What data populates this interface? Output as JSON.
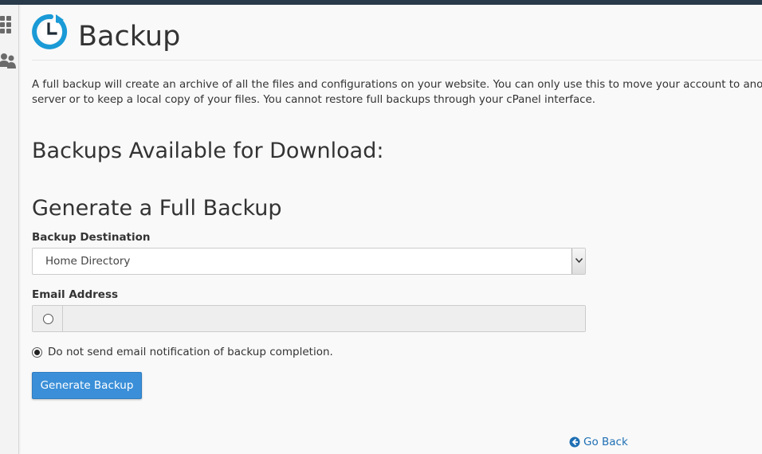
{
  "page": {
    "title": "Backup",
    "description": "A full backup will create an archive of all the files and configurations on your website. You can only use this to move your account to another server or to keep a local copy of your files. You cannot restore full backups through your cPanel interface."
  },
  "sections": {
    "available_heading": "Backups Available for Download:",
    "generate_heading": "Generate a Full Backup"
  },
  "form": {
    "destination_label": "Backup Destination",
    "destination_value": "Home Directory",
    "email_label": "Email Address",
    "email_value": "",
    "email_option_selected": false,
    "no_email_label": "Do not send email notification of backup completion.",
    "no_email_selected": true,
    "generate_button": "Generate Backup"
  },
  "nav": {
    "go_back": "Go Back"
  },
  "sidebar": {
    "icons": [
      "grid-icon",
      "users-icon"
    ]
  },
  "colors": {
    "accent": "#3a8fd8",
    "link": "#1f6fb4",
    "topbar": "#293a4a"
  }
}
